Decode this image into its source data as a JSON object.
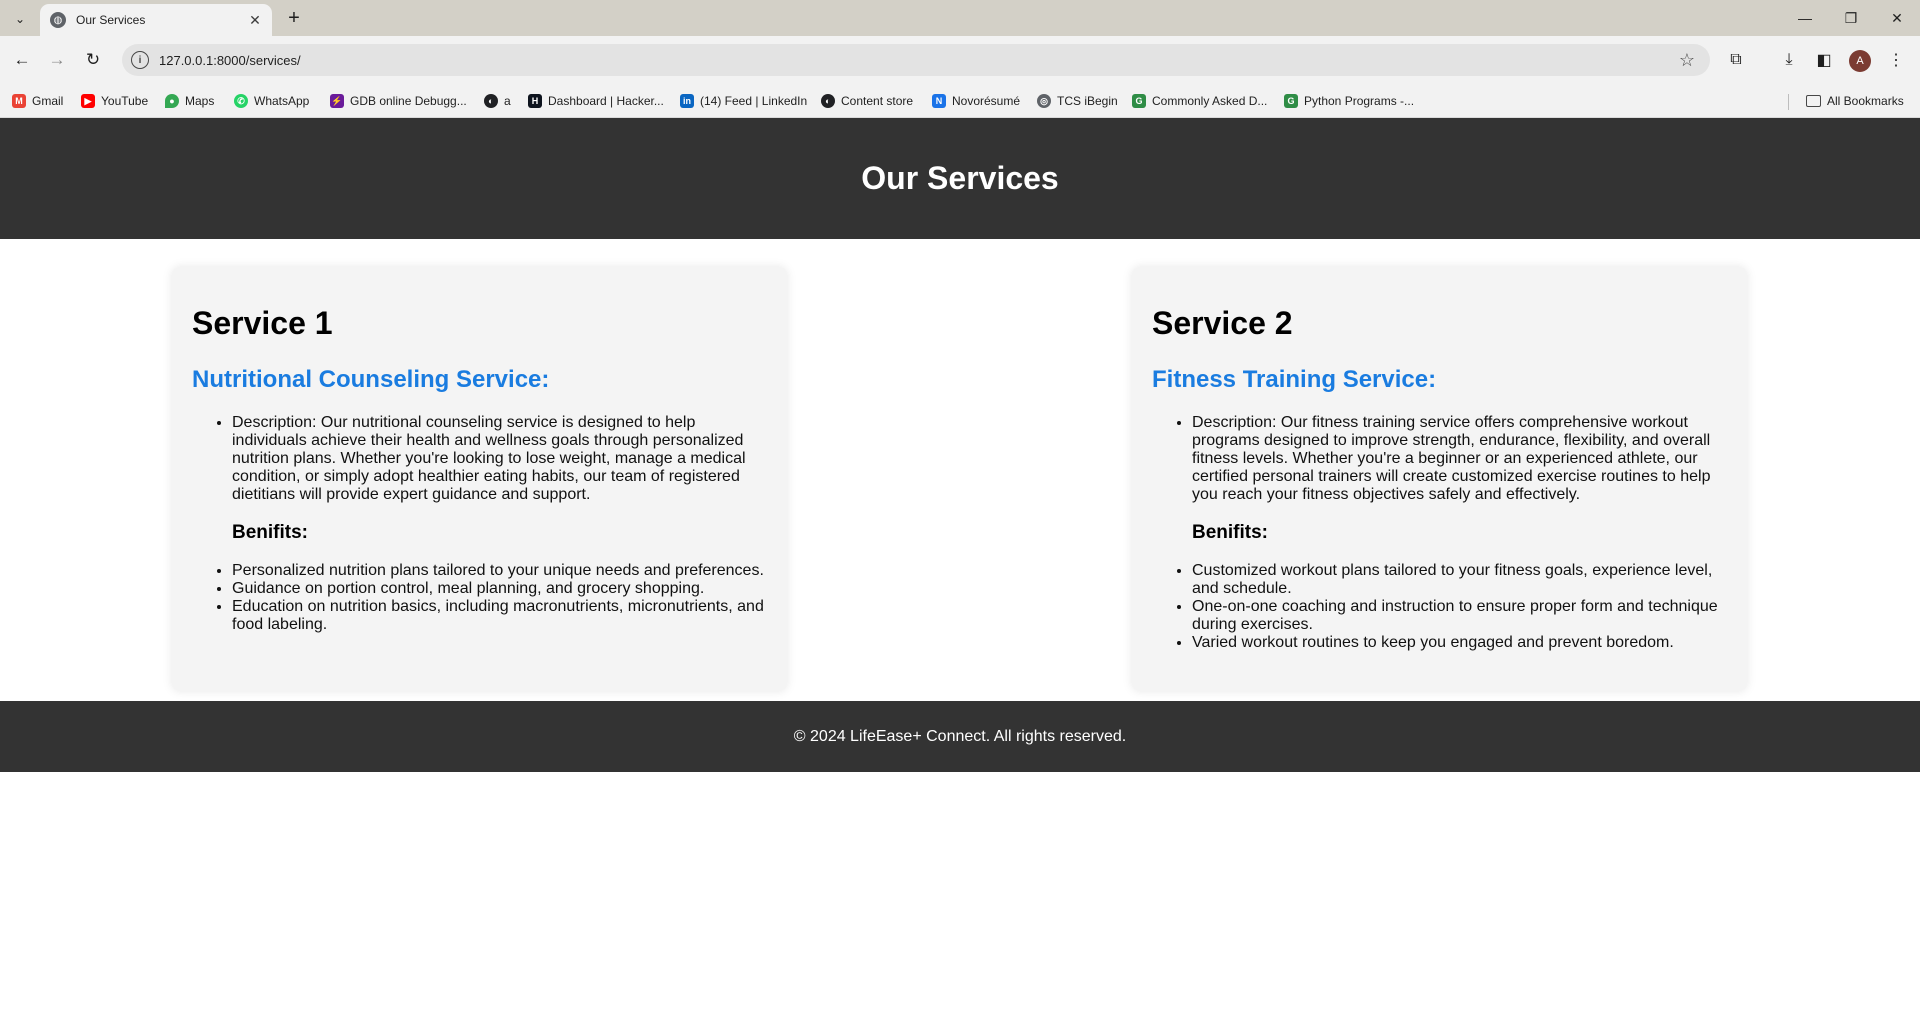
{
  "browser": {
    "tab_title": "Our Services",
    "url": "127.0.0.1:8000/services/",
    "bookmarks": [
      {
        "label": "Gmail",
        "color": "#ea4335",
        "glyph": "M"
      },
      {
        "label": "YouTube",
        "color": "#ff0000",
        "glyph": "▶"
      },
      {
        "label": "Maps",
        "color": "#34a853",
        "glyph": "◆"
      },
      {
        "label": "WhatsApp",
        "color": "#25d366",
        "glyph": "✆"
      },
      {
        "label": "GDB online Debugg...",
        "color": "#6a1b9a",
        "glyph": "⚡"
      },
      {
        "label": "a",
        "color": "#202124",
        "glyph": "◐"
      },
      {
        "label": "Dashboard | Hacker...",
        "color": "#0e141e",
        "glyph": "H"
      },
      {
        "label": "(14) Feed | LinkedIn",
        "color": "#0a66c2",
        "glyph": "in"
      },
      {
        "label": "Content store",
        "color": "#202124",
        "glyph": "◐"
      },
      {
        "label": "Novorésumé",
        "color": "#1a73e8",
        "glyph": "N"
      },
      {
        "label": "TCS iBegin",
        "color": "#5f6368",
        "glyph": "◎"
      },
      {
        "label": "Commonly Asked D...",
        "color": "#2f8d46",
        "glyph": "G"
      },
      {
        "label": "Python Programs -...",
        "color": "#2f8d46",
        "glyph": "G"
      }
    ],
    "all_bookmarks_label": "All Bookmarks"
  },
  "header": {
    "title": "Our Services"
  },
  "services": [
    {
      "heading": "Service 1",
      "subheading": "Nutritional Counseling Service:",
      "description": "Description: Our nutritional counseling service is designed to help individuals achieve their health and wellness goals through personalized nutrition plans. Whether you're looking to lose weight, manage a medical condition, or simply adopt healthier eating habits, our team of registered dietitians will provide expert guidance and support.",
      "benefits_title": "Benifits:",
      "benefits": [
        "Personalized nutrition plans tailored to your unique needs and preferences.",
        "Guidance on portion control, meal planning, and grocery shopping.",
        "Education on nutrition basics, including macronutrients, micronutrients, and food labeling."
      ]
    },
    {
      "heading": "Service 2",
      "subheading": "Fitness Training Service:",
      "description": "Description: Our fitness training service offers comprehensive workout programs designed to improve strength, endurance, flexibility, and overall fitness levels. Whether you're a beginner or an experienced athlete, our certified personal trainers will create customized exercise routines to help you reach your fitness objectives safely and effectively.",
      "benefits_title": "Benifits:",
      "benefits": [
        "Customized workout plans tailored to your fitness goals, experience level, and schedule.",
        "One-on-one coaching and instruction to ensure proper form and technique during exercises.",
        "Varied workout routines to keep you engaged and prevent boredom."
      ]
    }
  ],
  "footer": {
    "text": "© 2024 LifeEase+ Connect. All rights reserved."
  },
  "colors": {
    "header_bg": "#333333",
    "accent_blue": "#1a7ce0",
    "card_bg": "#f4f4f4"
  }
}
